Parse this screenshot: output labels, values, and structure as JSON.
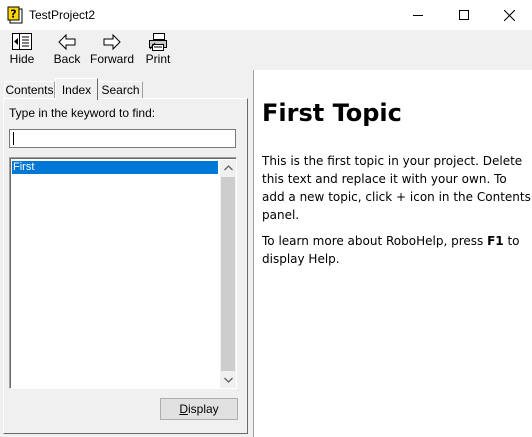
{
  "window": {
    "title": "TestProject2"
  },
  "toolbar": {
    "hide_label": "Hide",
    "back_label": "Back",
    "forward_label": "Forward",
    "print_label": "Print"
  },
  "tabs": {
    "contents": "Contents",
    "index": "Index",
    "search": "Search",
    "active": "Index"
  },
  "index_panel": {
    "keyword_label": "Type in the keyword to find:",
    "keyword_value": "",
    "items": [
      "First"
    ],
    "selected_item": "First",
    "display_label_prefix": "",
    "display_label_underlined": "D",
    "display_label_rest": "isplay"
  },
  "topic": {
    "title": "First Topic",
    "paragraph1": "This is the first topic in your project. Delete this text and replace it with your own. To add a new topic, click + icon in the Contents panel.",
    "paragraph2_before": "To learn more about RoboHelp, press ",
    "paragraph2_key": "F1",
    "paragraph2_after": " to display Help."
  },
  "colors": {
    "selection": "#0078d7",
    "toolbar_bg": "#f0f0f0"
  }
}
